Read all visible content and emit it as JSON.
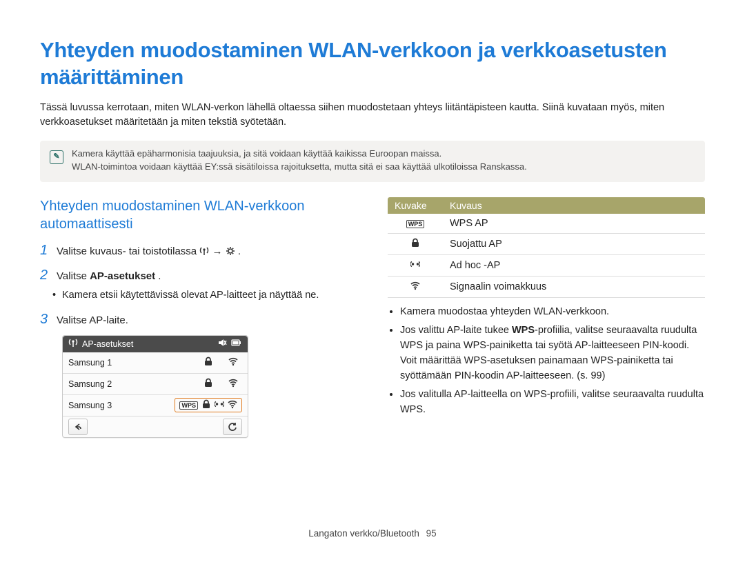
{
  "title": "Yhteyden muodostaminen WLAN-verkkoon ja verkkoasetusten määrittäminen",
  "intro": "Tässä luvussa kerrotaan, miten WLAN-verkon lähellä oltaessa siihen muodostetaan yhteys liitäntäpisteen kautta. Siinä kuvataan myös, miten verkkoasetukset määritetään ja miten tekstiä syötetään.",
  "notes": {
    "line1": "Kamera käyttää epäharmonisia taajuuksia, ja sitä voidaan käyttää kaikissa Euroopan maissa.",
    "line2": "WLAN-toimintoa voidaan käyttää EY:ssä sisätiloissa rajoituksetta, mutta sitä ei saa käyttää ulkotiloissa Ranskassa."
  },
  "left": {
    "heading": "Yhteyden muodostaminen WLAN-verkkoon automaattisesti",
    "step1_prefix": "Valitse kuvaus- tai toistotilassa ",
    "step1_suffix": " .",
    "step2_prefix": "Valitse ",
    "step2_bold": "AP-asetukset",
    "step2_suffix": ".",
    "step2_bullet": "Kamera etsii käytettävissä olevat AP-laitteet ja näyttää ne.",
    "step3": "Valitse AP-laite.",
    "panel": {
      "title": "AP-asetukset",
      "rows": [
        {
          "name": "Samsung 1",
          "wps": false,
          "lock": true,
          "adhoc": false,
          "wifi": true,
          "boxed": false
        },
        {
          "name": "Samsung 2",
          "wps": false,
          "lock": true,
          "adhoc": false,
          "wifi": true,
          "boxed": false
        },
        {
          "name": "Samsung 3",
          "wps": true,
          "lock": true,
          "adhoc": true,
          "wifi": true,
          "boxed": true
        }
      ]
    }
  },
  "right": {
    "table": {
      "head_icon": "Kuvake",
      "head_desc": "Kuvaus",
      "rows": [
        {
          "icon": "WPS",
          "label": "WPS AP"
        },
        {
          "icon": "lock",
          "label": "Suojattu AP"
        },
        {
          "icon": "adhoc",
          "label": "Ad hoc -AP"
        },
        {
          "icon": "wifi",
          "label": "Signaalin voimakkuus"
        }
      ]
    },
    "bullets": {
      "b1": "Kamera muodostaa yhteyden WLAN-verkkoon.",
      "b2_a": "Jos valittu AP-laite tukee ",
      "b2_bold": "WPS",
      "b2_b": "-profiilia, valitse seuraavalta ruudulta WPS ja paina WPS-painiketta tai syötä AP-laitteeseen PIN-koodi. Voit määrittää WPS-asetuksen painamaan WPS-painiketta tai syöttämään PIN-koodin AP-laitteeseen. (s. 99)",
      "b3": "Jos valitulla AP-laitteella on WPS-profiili, valitse seuraavalta ruudulta WPS."
    }
  },
  "footer": {
    "section": "Langaton verkko/Bluetooth",
    "page": "95"
  },
  "chart_data": {
    "type": "table",
    "title": "AP icon legend",
    "columns": [
      "Kuvake",
      "Kuvaus"
    ],
    "rows": [
      [
        "WPS",
        "WPS AP"
      ],
      [
        "lock",
        "Suojattu AP"
      ],
      [
        "adhoc",
        "Ad hoc -AP"
      ],
      [
        "wifi",
        "Signaalin voimakkuus"
      ]
    ]
  }
}
